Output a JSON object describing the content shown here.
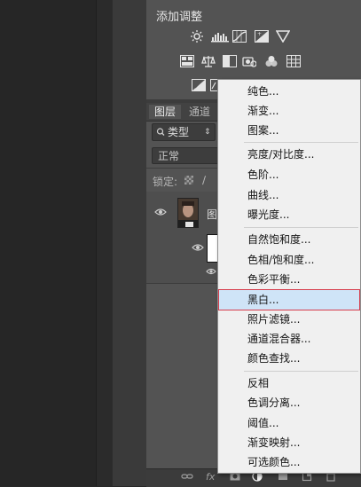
{
  "adjustments": {
    "title": "添加调整",
    "icons": {
      "row1": [
        "brightness-contrast-icon",
        "levels-icon",
        "curves-icon",
        "exposure-icon",
        "triangle-icon"
      ],
      "row2": [
        "vibrance-icon",
        "color-balance-icon",
        "black-white-icon",
        "photo-filter-icon",
        "channel-mixer-icon",
        "color-lookup-icon"
      ],
      "row3": [
        "invert-icon",
        "posterize-icon"
      ]
    }
  },
  "layers": {
    "tabs": [
      "图层",
      "通道"
    ],
    "filter_kind": "类型",
    "blend_mode": "正常",
    "lock_label": "锁定:",
    "layer_name_initial": "图"
  },
  "bottom_bar_icons": [
    "link-icon",
    "fx-icon",
    "mask-icon",
    "adjustment-icon",
    "group-icon",
    "new-layer-icon",
    "delete-icon"
  ],
  "menu": {
    "groups": [
      [
        "纯色...",
        "渐变...",
        "图案..."
      ],
      [
        "亮度/对比度...",
        "色阶...",
        "曲线...",
        "曝光度..."
      ],
      [
        "自然饱和度...",
        "色相/饱和度...",
        "色彩平衡...",
        "黑白...",
        "照片滤镜...",
        "通道混合器...",
        "颜色查找..."
      ],
      [
        "反相",
        "色调分离...",
        "阈值...",
        "渐变映射...",
        "可选颜色..."
      ]
    ],
    "highlighted": "黑白..."
  },
  "colors": {
    "highlight_fill": "#cfe4f7",
    "highlight_border": "#d63d4d",
    "panel": "#535353"
  }
}
